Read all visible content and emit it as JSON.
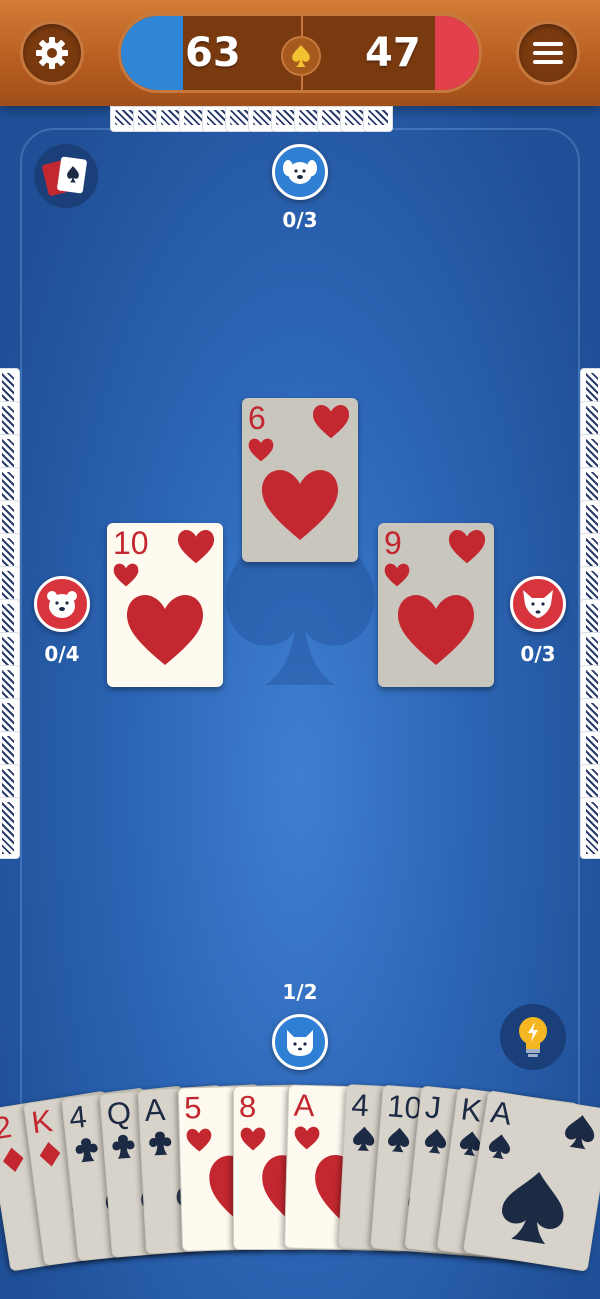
{
  "scores": {
    "team_blue": "63",
    "team_red": "47"
  },
  "players": {
    "north": {
      "bid": "0/3",
      "avatar": "dog-icon"
    },
    "west": {
      "bid": "0/4",
      "avatar": "bear-icon"
    },
    "east": {
      "bid": "0/3",
      "avatar": "fox-icon"
    },
    "south": {
      "bid": "1/2",
      "avatar": "cat-icon"
    }
  },
  "trick": [
    {
      "player": "north",
      "rank": "6",
      "suit": "hearts",
      "dimmed": true
    },
    {
      "player": "west",
      "rank": "10",
      "suit": "hearts",
      "dimmed": false
    },
    {
      "player": "east",
      "rank": "9",
      "suit": "hearts",
      "dimmed": true
    }
  ],
  "hand": [
    {
      "rank": "2",
      "suit": "diamonds",
      "dimmed": true
    },
    {
      "rank": "K",
      "suit": "diamonds",
      "dimmed": true
    },
    {
      "rank": "4",
      "suit": "clubs",
      "dimmed": true
    },
    {
      "rank": "Q",
      "suit": "clubs",
      "dimmed": true
    },
    {
      "rank": "A",
      "suit": "clubs",
      "dimmed": true
    },
    {
      "rank": "5",
      "suit": "hearts",
      "dimmed": false
    },
    {
      "rank": "8",
      "suit": "hearts",
      "dimmed": false
    },
    {
      "rank": "A",
      "suit": "hearts",
      "dimmed": false
    },
    {
      "rank": "4",
      "suit": "spades",
      "dimmed": true
    },
    {
      "rank": "10",
      "suit": "spades",
      "dimmed": true
    },
    {
      "rank": "J",
      "suit": "spades",
      "dimmed": true
    },
    {
      "rank": "K",
      "suit": "spades",
      "dimmed": true
    },
    {
      "rank": "A",
      "suit": "spades",
      "dimmed": true
    }
  ],
  "colors": {
    "team_blue": "#2f86d6",
    "team_red": "#e2404a",
    "felt": "#2d66b6",
    "wood": "#b95f22"
  },
  "icons": {
    "settings": "gear-icon",
    "menu": "hamburger-icon",
    "deck": "cards-icon",
    "hint": "lightbulb-icon"
  }
}
